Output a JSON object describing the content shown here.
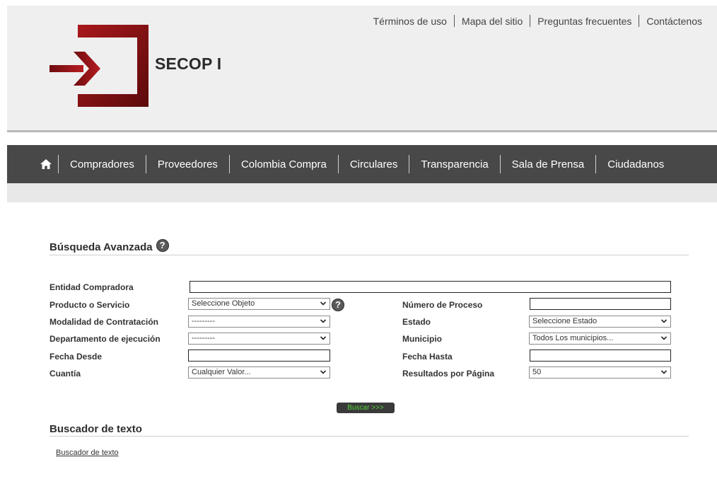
{
  "header": {
    "brand": "SECOP I",
    "top_links": [
      "Términos de uso",
      "Mapa del sitio",
      "Preguntas frecuentes",
      "Contáctenos"
    ],
    "brand_color": "#8b1014"
  },
  "nav": {
    "home_icon": "home-icon",
    "items": [
      "Compradores",
      "Proveedores",
      "Colombia Compra",
      "Circulares",
      "Transparencia",
      "Sala de Prensa",
      "Ciudadanos"
    ]
  },
  "advanced_search": {
    "title": "Búsqueda Avanzada",
    "help_icon": "question-icon",
    "fields": {
      "entidad": {
        "label": "Entidad Compradora",
        "value": ""
      },
      "producto": {
        "label": "Producto o Servicio",
        "value": "Seleccione Objeto"
      },
      "modalidad": {
        "label": "Modalidad de Contratación",
        "value": "---------"
      },
      "departamento": {
        "label": "Departamento de ejecución",
        "value": "---------"
      },
      "fecha_desde": {
        "label": "Fecha Desde",
        "value": ""
      },
      "cuantia": {
        "label": "Cuantía",
        "value": "Cualquier Valor..."
      },
      "numero_proceso": {
        "label": "Número de Proceso",
        "value": ""
      },
      "estado": {
        "label": "Estado",
        "value": "Seleccione Estado"
      },
      "municipio": {
        "label": "Municipio",
        "value": "Todos Los municipios..."
      },
      "fecha_hasta": {
        "label": "Fecha Hasta",
        "value": ""
      },
      "resultados": {
        "label": "Resultados por Página",
        "value": "50"
      }
    },
    "search_button": "Buscar >>>"
  },
  "text_search": {
    "title": "Buscador de texto",
    "link": "Buscador de texto"
  }
}
